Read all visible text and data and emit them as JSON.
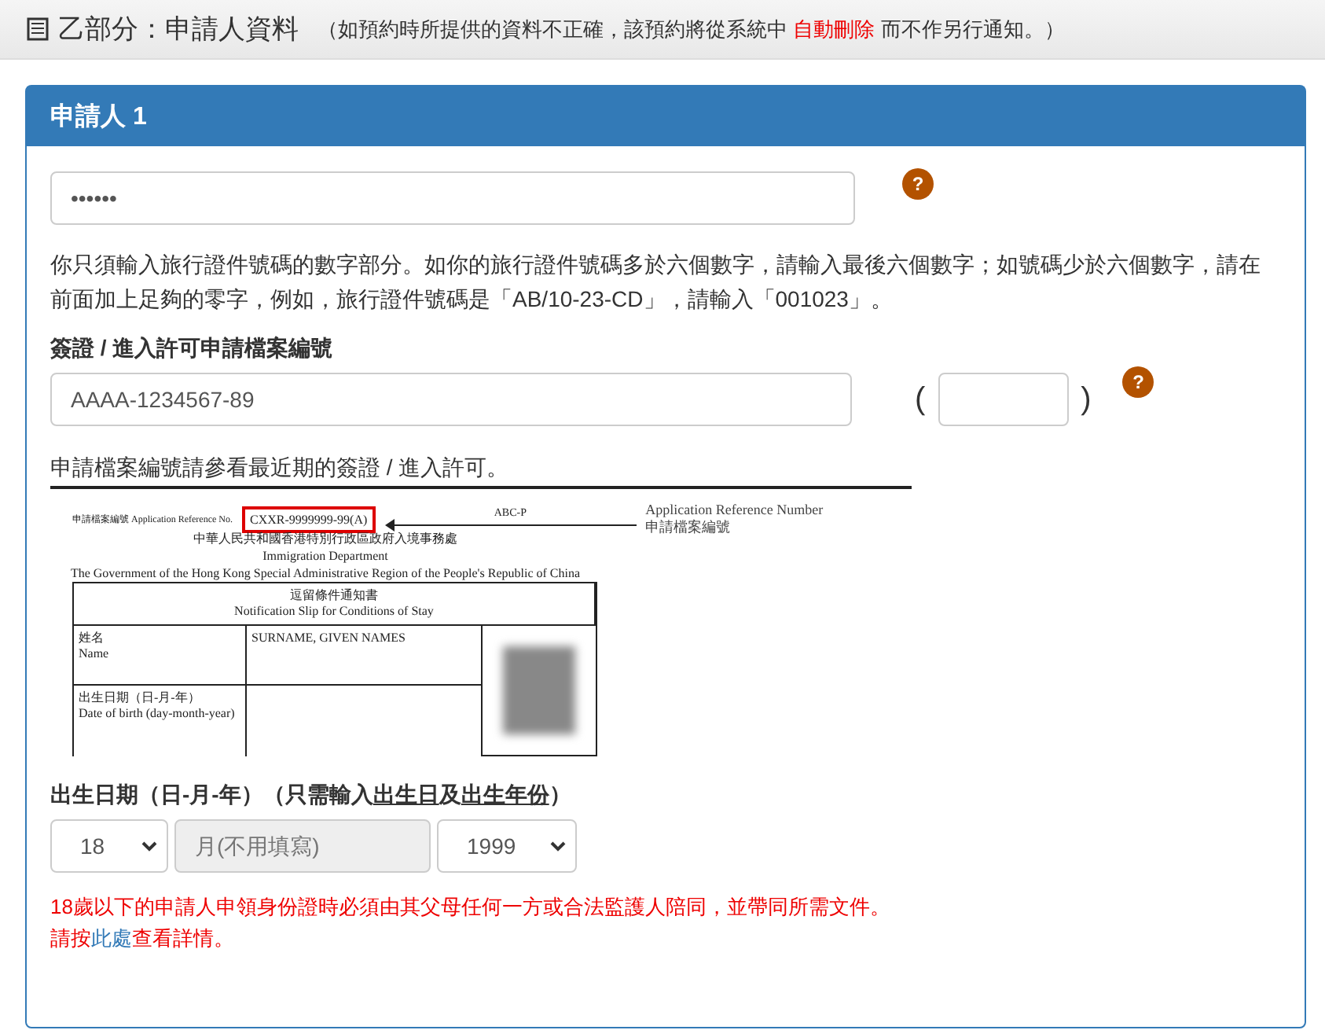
{
  "section_header": {
    "title": "乙部分：申請人資料",
    "note_before": "（如預約時所提供的資料不正確，該預約將從系統中",
    "note_highlight": "自動刪除",
    "note_after": "而不作另行通知。）"
  },
  "panel": {
    "title": "申請人 1",
    "travel_document": {
      "value": "••••••",
      "help_icon": "?",
      "hint": "你只須輸入旅行證件號碼的數字部分。如你的旅行證件號碼多於六個數字，請輸入最後六個數字；如號碼少於六個數字，請在前面加上足夠的零字，例如，旅行證件號碼是「AB/10-23-CD」，請輸入「001023」。"
    },
    "reference": {
      "label": "簽證 / 進入許可申請檔案編號",
      "value": "AAAA-1234567-89",
      "open_paren": "(",
      "close_paren": ")",
      "help_icon": "?",
      "sample_caption": "申請檔案編號請參看最近期的簽證 / 進入許可。"
    },
    "sample_document": {
      "ref_label": "申請檔案編號 Application Reference No.",
      "ref_value": "CXXR-9999999-99(A)",
      "ref_code": "ABC-P",
      "callout_en": "Application Reference Number",
      "callout_zh": "申請檔案編號",
      "dept_zh": "中華人民共和國香港特別行政區政府入境事務處",
      "dept_en": "Immigration Department",
      "government": "The Government of the Hong Kong Special Administrative Region of the People's Republic of China",
      "slip_zh": "逗留條件通知書",
      "slip_en": "Notification Slip for Conditions of Stay",
      "name_label_zh": "姓名",
      "name_label_en": "Name",
      "name_value": "SURNAME, GIVEN NAMES",
      "dob_label_zh": "出生日期（日-月-年）",
      "dob_label_en": "Date of birth (day-month-year)"
    },
    "date_of_birth": {
      "label_segments": [
        {
          "text": "出生日期（日-月-年）（只需輸入",
          "underlined": false
        },
        {
          "text": "出生日",
          "underlined": true
        },
        {
          "text": "及",
          "underlined": false
        },
        {
          "text": "出生年份",
          "underlined": true
        },
        {
          "text": "）",
          "underlined": false
        }
      ],
      "fields": [
        {
          "kind": "select",
          "value": "18",
          "disabled": false
        },
        {
          "kind": "text",
          "placeholder": "月(不用填寫)",
          "disabled": true
        },
        {
          "kind": "select",
          "value": "1999",
          "disabled": false
        }
      ]
    },
    "notice": {
      "line_1": "18歲以下的申請人申領身份證時必須由其父母任何一方或合法監護人陪同，並帶同所需文件。",
      "line_2_before": "請按",
      "line_2_link": "此處",
      "line_2_after": "查看詳情。"
    }
  }
}
